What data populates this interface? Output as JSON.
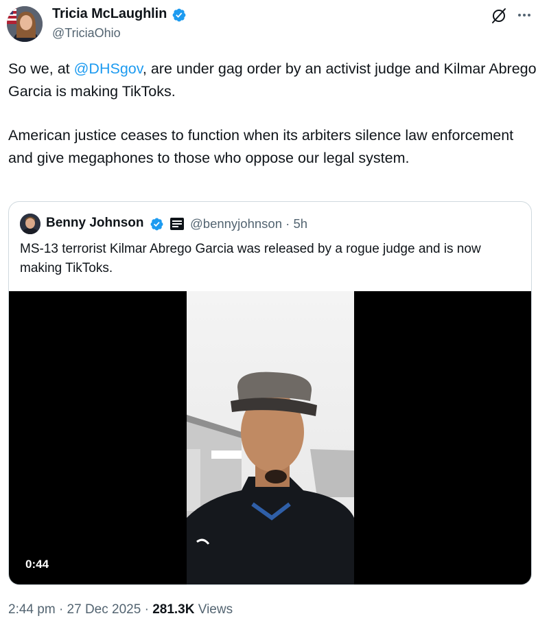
{
  "author": {
    "name": "Tricia McLaughlin",
    "handle": "@TriciaOhio"
  },
  "icons": {
    "verified": "verified-badge-icon",
    "grok": "grok-icon",
    "more": "more-options-icon",
    "affiliation": "affiliation-badge-icon"
  },
  "post": {
    "line1_prefix": "So we, at ",
    "mention": "@DHSgov",
    "line1_suffix": ", are under gag order by an activist judge and Kilmar Abrego Garcia is making TikToks.",
    "paragraph2": "American justice ceases to function when its arbiters silence law enforcement and give megaphones to those who oppose our legal system."
  },
  "quote": {
    "name": "Benny Johnson",
    "handle": "@bennyjohnson",
    "separator": "·",
    "age": "5h",
    "text": "MS-13 terrorist Kilmar Abrego Garcia was released by a rogue judge and is now making TikToks.",
    "video_duration": "0:44"
  },
  "meta": {
    "time": "2:44 pm",
    "separator": "·",
    "date": "27 Dec 2025",
    "views_count": "281.3K",
    "views_label": "Views"
  },
  "colors": {
    "accent": "#1d9bf0",
    "text": "#0f1419",
    "secondary": "#536471",
    "border": "#cfd9de"
  }
}
